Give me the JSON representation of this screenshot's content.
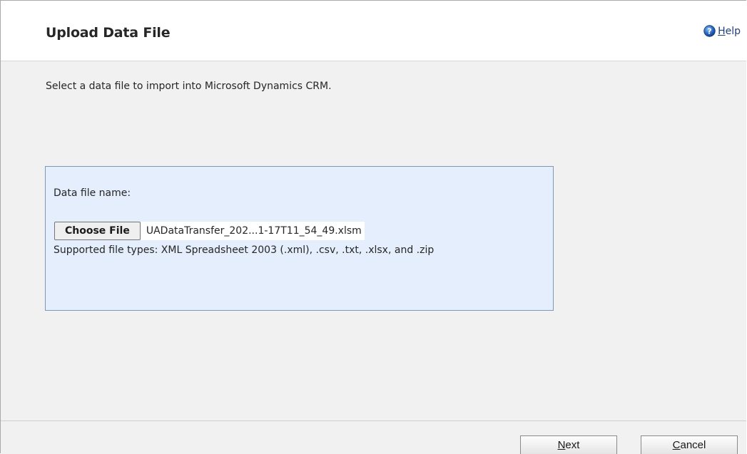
{
  "dialog": {
    "title": "Upload Data File",
    "help": {
      "access_key": "H",
      "rest": "elp",
      "icon": "help-icon"
    }
  },
  "body": {
    "instruction": "Select a data file to import into Microsoft Dynamics CRM.",
    "upload": {
      "label": "Data file name:",
      "choose_button": "Choose File",
      "selected_file": "UADataTransfer_202...1-17T11_54_49.xlsm",
      "supported_types": "Supported file types: XML Spreadsheet 2003 (.xml), .csv, .txt, .xlsx, and .zip"
    }
  },
  "footer": {
    "next": {
      "access_key": "N",
      "rest": "ext"
    },
    "cancel": {
      "access_key": "C",
      "rest": "ancel"
    }
  },
  "colors": {
    "upload_box_bg": "#e5eefc",
    "upload_box_border": "#7c98b6",
    "body_bg": "#f1f1f1",
    "help_link": "#1f3f74"
  }
}
